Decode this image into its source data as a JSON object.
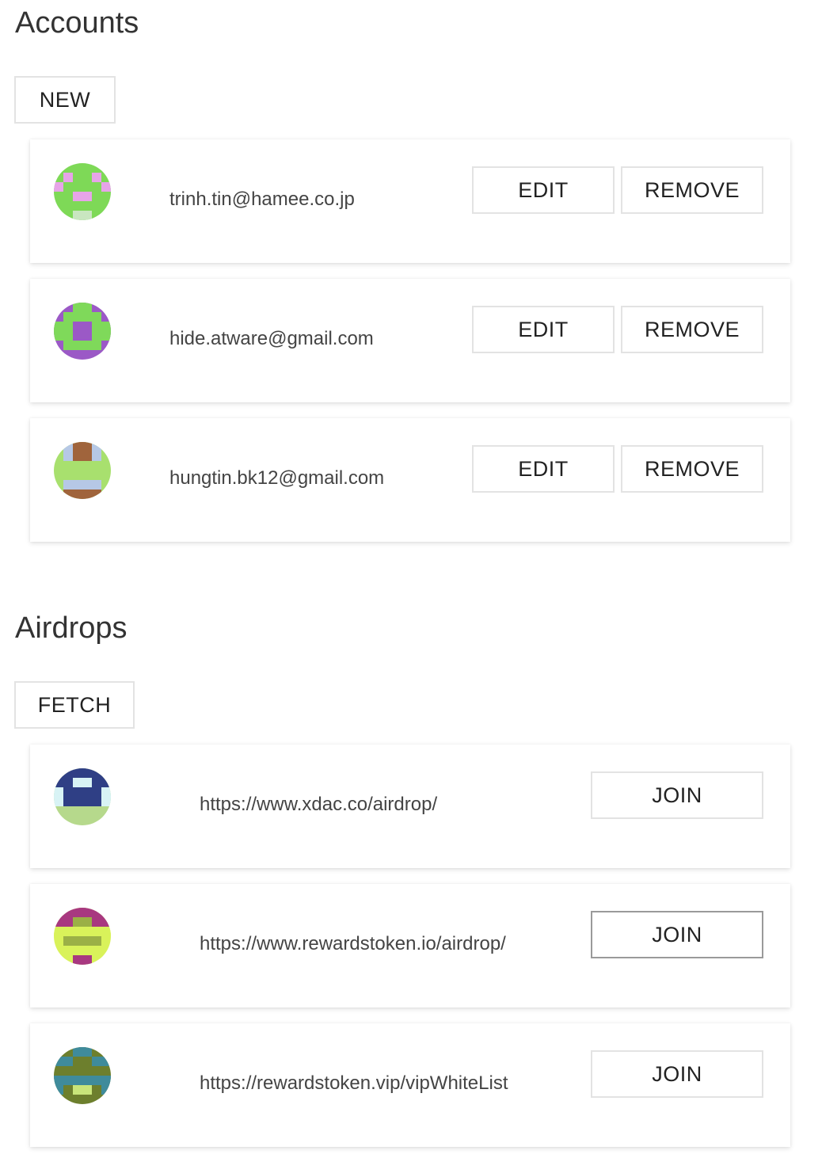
{
  "accounts": {
    "title": "Accounts",
    "new_label": "NEW",
    "items": [
      {
        "email": "trinh.tin@hamee.co.jp",
        "edit_label": "EDIT",
        "remove_label": "REMOVE"
      },
      {
        "email": "hide.atware@gmail.com",
        "edit_label": "EDIT",
        "remove_label": "REMOVE"
      },
      {
        "email": "hungtin.bk12@gmail.com",
        "edit_label": "EDIT",
        "remove_label": "REMOVE"
      }
    ]
  },
  "airdrops": {
    "title": "Airdrops",
    "fetch_label": "FETCH",
    "items": [
      {
        "url": "https://www.xdac.co/airdrop/",
        "join_label": "JOIN"
      },
      {
        "url": "https://www.rewardstoken.io/airdrop/",
        "join_label": "JOIN"
      },
      {
        "url": "https://rewardstoken.vip/vipWhiteList",
        "join_label": "JOIN"
      }
    ]
  },
  "colors": {
    "avatar_1": [
      "#7ed957",
      "#e7a4e8",
      "#c9e6c0"
    ],
    "avatar_2": [
      "#9b59c6",
      "#7fd95a"
    ],
    "avatar_3": [
      "#a8e06e",
      "#a0643c",
      "#b6c8e6"
    ],
    "avatar_4": [
      "#b6d98c",
      "#2f3f85",
      "#d8f3f5"
    ],
    "avatar_5": [
      "#d9f25a",
      "#a83880",
      "#9bb046"
    ],
    "avatar_6": [
      "#6d7f2d",
      "#3f8b9b",
      "#c9e57a"
    ]
  }
}
